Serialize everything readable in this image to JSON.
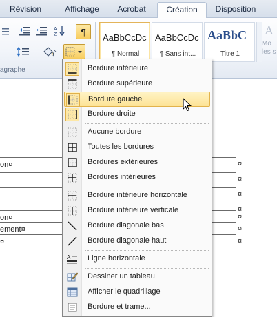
{
  "tabs": [
    {
      "label": "Révision",
      "active": false
    },
    {
      "label": "Affichage",
      "active": false
    },
    {
      "label": "Acrobat",
      "active": false
    },
    {
      "label": "Création",
      "active": true
    },
    {
      "label": "Disposition",
      "active": false
    }
  ],
  "ribbon": {
    "paragraph_group_label": "agraphe",
    "pilcrow": "¶",
    "styles": [
      {
        "sample": "AaBbCcDc",
        "name": "¶ Normal",
        "selected": true
      },
      {
        "sample": "AaBbCcDc",
        "name": "¶ Sans int...",
        "selected": false
      },
      {
        "sample": "AaBbC",
        "name": "Titre 1",
        "selected": false
      }
    ],
    "modify_styles": [
      "Mo",
      "les s"
    ]
  },
  "document": {
    "left_cells": [
      "on¤",
      "",
      "",
      "",
      "on¤",
      "ement¤",
      "¤"
    ],
    "right_mark": "¤"
  },
  "menu": {
    "items": [
      {
        "label": "Bordure inférieure",
        "icon": "border-bottom-icon",
        "checked": true,
        "hover": false
      },
      {
        "label": "Bordure supérieure",
        "icon": "border-top-icon",
        "checked": false,
        "hover": false
      },
      {
        "label": "Bordure gauche",
        "icon": "border-left-icon",
        "checked": true,
        "hover": true
      },
      {
        "label": "Bordure droite",
        "icon": "border-right-icon",
        "checked": true,
        "hover": false
      },
      {
        "label": "Aucune bordure",
        "icon": "no-border-icon",
        "checked": false,
        "hover": false
      },
      {
        "label": "Toutes les bordures",
        "icon": "all-borders-icon",
        "checked": false,
        "hover": false
      },
      {
        "label": "Bordures extérieures",
        "icon": "outside-borders-icon",
        "checked": false,
        "hover": false
      },
      {
        "label": "Bordures intérieures",
        "icon": "inside-borders-icon",
        "checked": false,
        "hover": false
      },
      {
        "label": "Bordure intérieure horizontale",
        "icon": "inside-horizontal-border-icon",
        "checked": false,
        "hover": false
      },
      {
        "label": "Bordure intérieure verticale",
        "icon": "inside-vertical-border-icon",
        "checked": false,
        "hover": false
      },
      {
        "label": "Bordure diagonale bas",
        "icon": "diagonal-down-border-icon",
        "checked": false,
        "hover": false
      },
      {
        "label": "Bordure diagonale haut",
        "icon": "diagonal-up-border-icon",
        "checked": false,
        "hover": false
      },
      {
        "label": "Ligne horizontale",
        "icon": "horizontal-line-icon",
        "checked": false,
        "hover": false
      },
      {
        "label": "Dessiner un tableau",
        "icon": "draw-table-icon",
        "checked": false,
        "hover": false
      },
      {
        "label": "Afficher le quadrillage",
        "icon": "view-gridlines-icon",
        "checked": false,
        "hover": false
      },
      {
        "label": "Bordure et trame...",
        "icon": "borders-shading-icon",
        "checked": false,
        "hover": false
      }
    ]
  },
  "colors": {
    "hover_fill": "#fde396",
    "hover_border": "#e2b34c",
    "ribbon_text": "#274a76"
  }
}
